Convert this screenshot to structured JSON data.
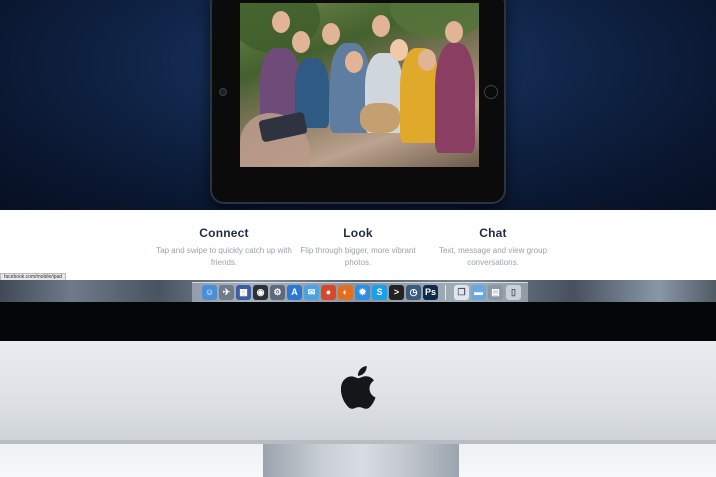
{
  "features": [
    {
      "title": "Connect",
      "text": "Tap and swipe to quickly catch up with friends."
    },
    {
      "title": "Look",
      "text": "Flip through bigger, more vibrant photos."
    },
    {
      "title": "Chat",
      "text": "Text, message and view group conversations."
    }
  ],
  "status_url": "facebook.com/mobile/ipad",
  "dock": {
    "items": [
      {
        "name": "finder-icon",
        "glyph": "☺",
        "color": "#4a90d9"
      },
      {
        "name": "launchpad-icon",
        "glyph": "✈",
        "color": "#6f7c8a"
      },
      {
        "name": "mission-control-icon",
        "glyph": "▦",
        "color": "#3b5f9c"
      },
      {
        "name": "dashboard-icon",
        "glyph": "◉",
        "color": "#2f2f36"
      },
      {
        "name": "system-preferences-icon",
        "glyph": "⚙",
        "color": "#5d6a78"
      },
      {
        "name": "app-store-icon",
        "glyph": "A",
        "color": "#2a78d4"
      },
      {
        "name": "messages-icon",
        "glyph": "✉",
        "color": "#4aa3e0"
      },
      {
        "name": "chrome-icon",
        "glyph": "●",
        "color": "#d9472b"
      },
      {
        "name": "firefox-icon",
        "glyph": "◐",
        "color": "#e0701f"
      },
      {
        "name": "safari-icon",
        "glyph": "✹",
        "color": "#2f8de4"
      },
      {
        "name": "skype-icon",
        "glyph": "S",
        "color": "#1aa0e8"
      },
      {
        "name": "terminal-icon",
        "glyph": ">",
        "color": "#222"
      },
      {
        "name": "time-machine-icon",
        "glyph": "◷",
        "color": "#3a5b7a"
      },
      {
        "name": "photoshop-icon",
        "glyph": "Ps",
        "color": "#0d2a4a"
      },
      {
        "name": "documents-icon",
        "glyph": "❐",
        "color": "#dfe6ee"
      },
      {
        "name": "folder-icon",
        "glyph": "▬",
        "color": "#6aa8e0"
      },
      {
        "name": "downloads-icon",
        "glyph": "▤",
        "color": "#8a97a5"
      },
      {
        "name": "trash-icon",
        "glyph": "▯",
        "color": "#c8d0d8"
      }
    ]
  }
}
